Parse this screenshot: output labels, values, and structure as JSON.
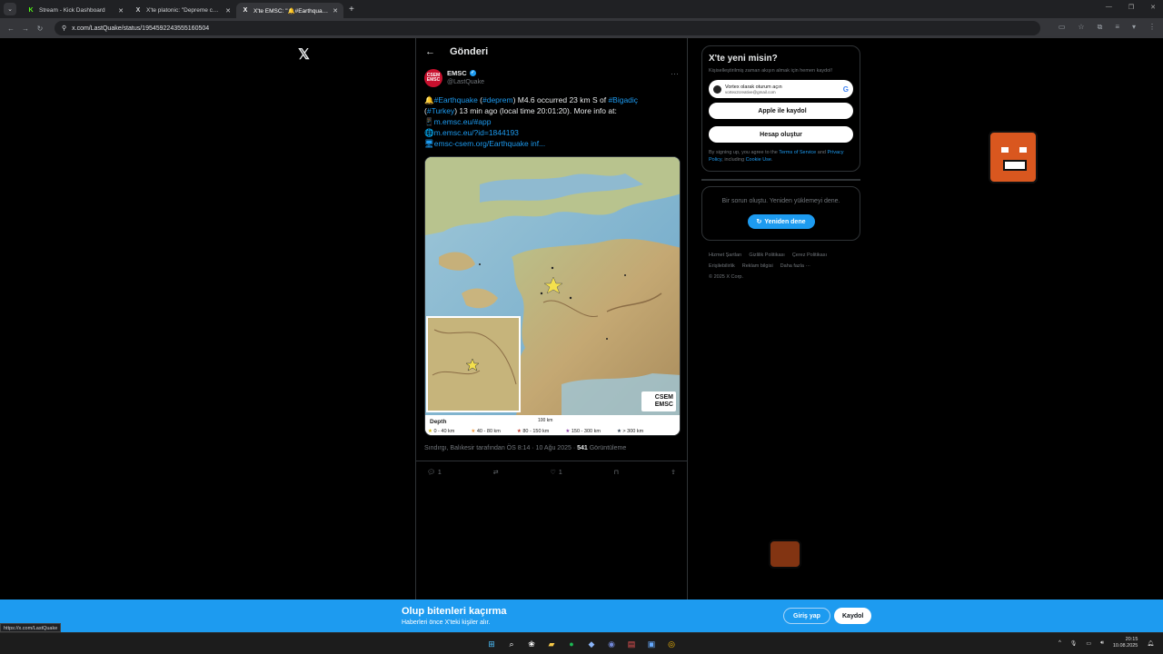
{
  "browser": {
    "tabs": [
      {
        "title": "Stream - Kick Dashboard",
        "fav": "K",
        "fav_color": "#53fc18",
        "active": false
      },
      {
        "title": "X'te platonic: \"Depreme canlı y...",
        "fav": "X",
        "fav_color": "#ffffff",
        "active": false
      },
      {
        "title": "X'te EMSC: \"🔔#Earthquake (#...",
        "fav": "X",
        "fav_color": "#ffffff",
        "active": true
      }
    ],
    "new_tab": "+",
    "url": "x.com/LastQuake/status/1954592243555160504"
  },
  "post": {
    "header_title": "Gönderi",
    "author_name": "EMSC",
    "author_handle": "@LastQuake",
    "avatar_text": "CSEM EMSC",
    "text_line1_pre": "🔔",
    "text_hashtag1": "#Earthquake",
    "text_paren_open": " (",
    "text_hashtag2": "#deprem",
    "text_line1_mid": ") M4.6 occurred 23 km S of ",
    "text_hashtag3": "#Bigadiç",
    "text_line2_open": "(",
    "text_hashtag4": "#Turkey",
    "text_line2_rest": ") 13 min ago (local time 20:01:20). More info at:",
    "link1": "📱m.emsc.eu/#app",
    "link2": "🌐m.emsc.eu/?id=1844193",
    "link3": "🖥emsc-csem.org/Earthquake inf...",
    "map": {
      "legend_title": "Depth",
      "legend_items": [
        "0 - 40 km",
        "40 - 80 km",
        "80 - 150 km",
        "150 - 300 km",
        "> 300 km"
      ],
      "legend_colors": [
        "#f4e04d",
        "#f29a3a",
        "#c0392b",
        "#8e44ad",
        "#2c3e50"
      ],
      "scale_label": "100 km",
      "inset_scale": "20 km",
      "badge": "CSEM EMSC",
      "labels": [
        "İzmir",
        "Manisa",
        "Bigadiç"
      ]
    },
    "meta_location": "Sındırgı, Balıkesir tarafından ÖS 8:14 · 10 Ağu 2025 · ",
    "meta_views_count": "541",
    "meta_views_label": " Görüntüleme",
    "actions": {
      "reply": "1",
      "retweet": "",
      "like": "1"
    }
  },
  "sidebar": {
    "title": "X'te yeni misin?",
    "subtitle": "Kişiselleştirilmiş zaman akışın almak için hemen kaydol!",
    "google_account_name": "Vortex olarak oturum açın",
    "google_account_email": "vortex2creative@gmail.com",
    "apple_label": "Apple ile kaydol",
    "create_label": "Hesap oluştur",
    "terms_pre": "By signing up, you agree to the ",
    "terms_link1": "Terms of Service",
    "terms_and": " and ",
    "terms_link2": "Privacy Policy",
    "terms_mid": ", including ",
    "terms_link3": "Cookie Use",
    "terms_end": ".",
    "error_msg": "Bir sorun oluştu. Yeniden yüklemeyi dene.",
    "retry_label": "Yeniden dene",
    "footer": [
      "Hizmet Şartları",
      "Gizlilik Politikası",
      "Çerez Politikası",
      "Erişilebilirlik",
      "Reklam bilgisi",
      "Daha fazla ···",
      "© 2025 X Corp."
    ]
  },
  "banner": {
    "title": "Olup bitenleri kaçırma",
    "subtitle": "Haberleri önce X'teki kişiler alır.",
    "login_label": "Giriş yap",
    "signup_label": "Kaydol"
  },
  "status_url": "https://x.com/LastQuake",
  "taskbar": {
    "time": "20:15",
    "date": "10.08.2025"
  }
}
